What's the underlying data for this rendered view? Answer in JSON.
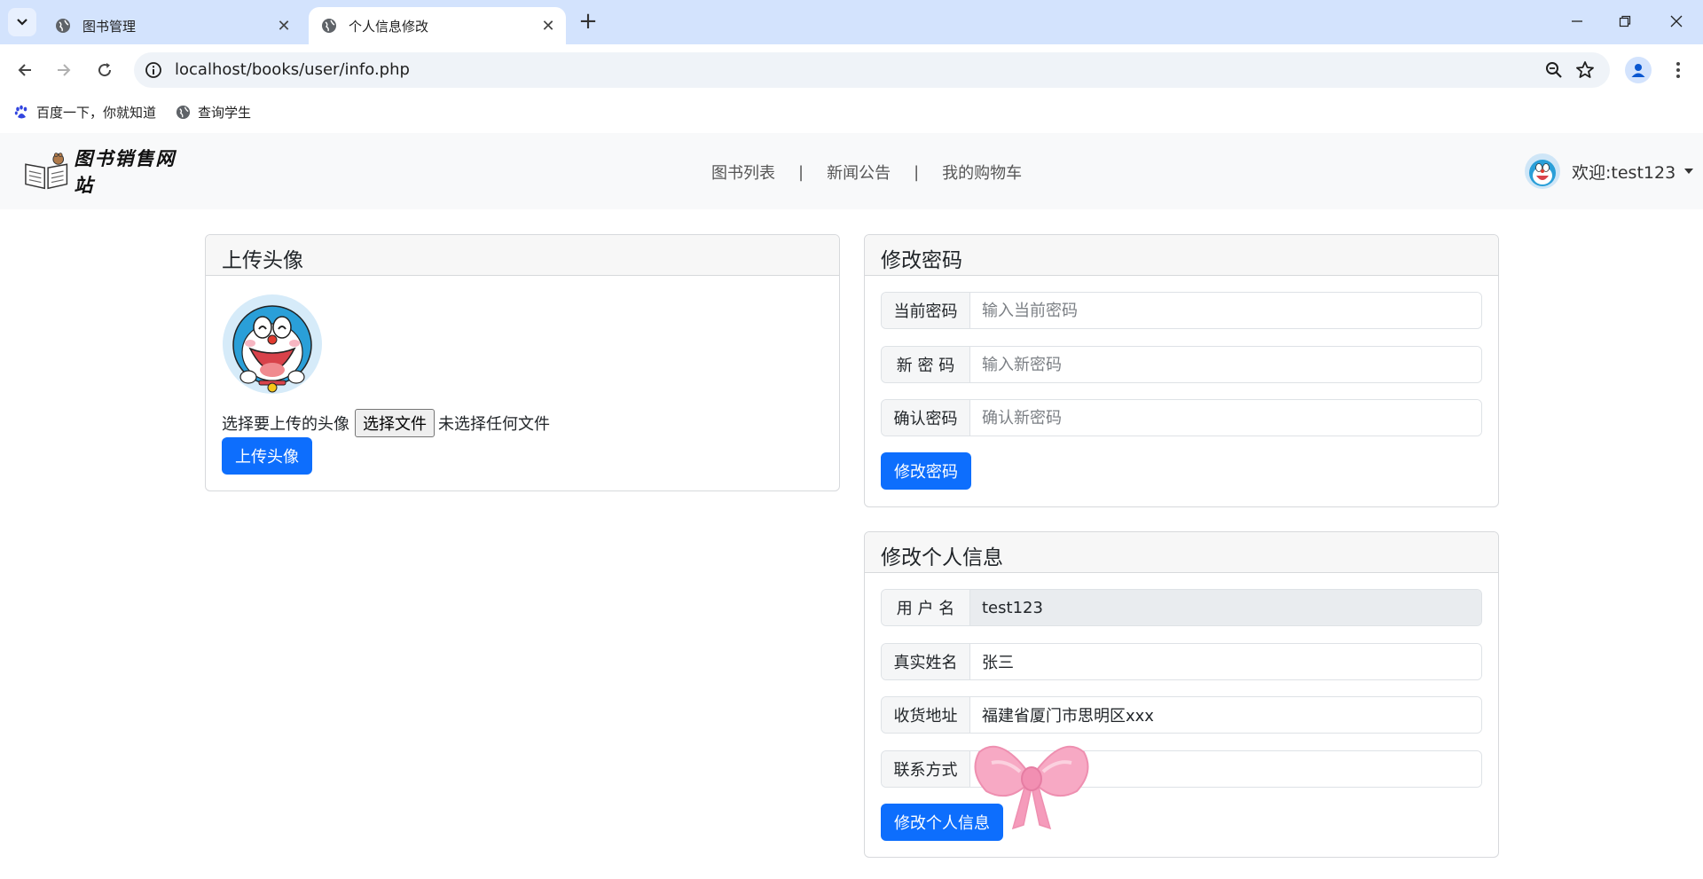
{
  "browser": {
    "tabs": [
      {
        "title": "图书管理",
        "active": false
      },
      {
        "title": "个人信息修改",
        "active": true
      }
    ],
    "url": "localhost/books/user/info.php",
    "bookmarks": [
      {
        "label": "百度一下，你就知道",
        "icon": "paw-icon"
      },
      {
        "label": "查询学生",
        "icon": "globe-icon"
      }
    ]
  },
  "site": {
    "logo_text": "图书销售网站",
    "menu": [
      "图书列表",
      "新闻公告",
      "我的购物车"
    ],
    "separator": "|",
    "welcome": "欢迎:test123"
  },
  "avatar_card": {
    "title": "上传头像",
    "choose_label": "选择要上传的头像",
    "file_button": "选择文件",
    "no_file": "未选择任何文件",
    "upload_button": "上传头像"
  },
  "password_card": {
    "title": "修改密码",
    "fields": [
      {
        "label": "当前密码",
        "placeholder": "输入当前密码",
        "value": ""
      },
      {
        "label": "新 密 码",
        "placeholder": "输入新密码",
        "value": ""
      },
      {
        "label": "确认密码",
        "placeholder": "确认新密码",
        "value": ""
      }
    ],
    "submit": "修改密码"
  },
  "info_card": {
    "title": "修改个人信息",
    "fields": [
      {
        "label": "用 户 名",
        "value": "test123",
        "readonly": true
      },
      {
        "label": "真实姓名",
        "value": "张三",
        "readonly": false
      },
      {
        "label": "收货地址",
        "value": "福建省厦门市思明区xxx",
        "readonly": false
      },
      {
        "label": "联系方式",
        "value": "",
        "readonly": false
      }
    ],
    "submit": "修改个人信息"
  },
  "colors": {
    "primary": "#0d6efd",
    "tabbar": "#d3e3fd",
    "navbar": "#f8f9fa"
  }
}
